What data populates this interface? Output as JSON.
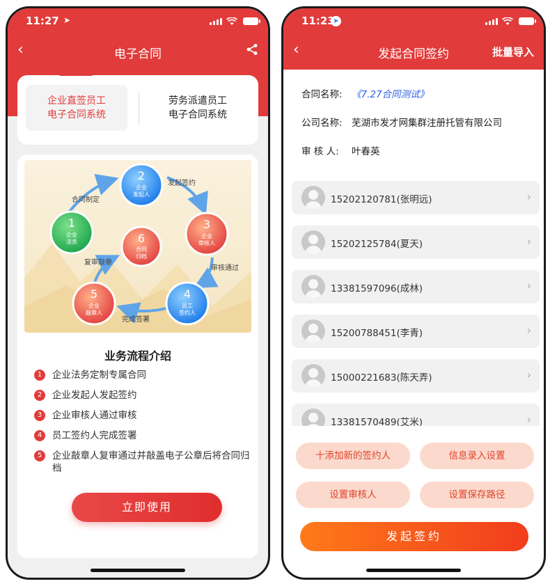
{
  "left": {
    "status": {
      "time": "11:27"
    },
    "nav": {
      "title": "电子合同"
    },
    "tabs": [
      {
        "line1": "企业直签员工",
        "line2": "电子合同系统"
      },
      {
        "line1": "劳务派遣员工",
        "line2": "电子合同系统"
      }
    ],
    "flow": {
      "nodes": [
        {
          "num": "1",
          "label1": "企业",
          "label2": "法务"
        },
        {
          "num": "2",
          "label1": "企业",
          "label2": "发起人"
        },
        {
          "num": "3",
          "label1": "企业",
          "label2": "审核人"
        },
        {
          "num": "4",
          "label1": "员工",
          "label2": "签约人"
        },
        {
          "num": "5",
          "label1": "企业",
          "label2": "敲章人"
        },
        {
          "num": "6",
          "label1": "合同",
          "label2": "归档"
        }
      ],
      "arrows": [
        "合同制定",
        "发起签约",
        "审核通过",
        "完成签署",
        "复审敲章"
      ]
    },
    "section_title": "业务流程介绍",
    "steps": [
      {
        "num": "1",
        "text": "企业法务定制专属合同"
      },
      {
        "num": "2",
        "text": "企业发起人发起签约"
      },
      {
        "num": "3",
        "text": "企业审核人通过审核"
      },
      {
        "num": "4",
        "text": "员工签约人完成签署"
      },
      {
        "num": "5",
        "text": "企业敲章人复审通过并敲盖电子公章后将合同归档"
      }
    ],
    "use_button": "立即使用"
  },
  "right": {
    "status": {
      "time": "11:23"
    },
    "nav": {
      "title": "发起合同签约",
      "action": "批量导入"
    },
    "info": {
      "contract_label": "合同名称:",
      "contract_value": "《7.27合同测试》",
      "company_label": "公司名称:",
      "company_value": "芜湖市发才网集群注册托管有限公司",
      "reviewer_label": "审 核 人:",
      "reviewer_value": "叶春英"
    },
    "signers": [
      "15202120781(张明远)",
      "15202125784(夏天)",
      "13381597096(成林)",
      "15200788451(李青)",
      "15000221683(陈天弄)",
      "13381570489(艾米)"
    ],
    "buttons": {
      "add_signer": "十添加新的签约人",
      "info_settings": "信息录入设置",
      "set_reviewer": "设置审核人",
      "save_path": "设置保存路径",
      "sign": "发起签约"
    },
    "colors": {
      "accent": "#e23b3b",
      "sign_button": "#f5561c"
    },
    "icons": [
      "back-chevron-icon",
      "share-icon",
      "location-arrow-icon",
      "signal-icon",
      "wifi-icon",
      "battery-icon",
      "avatar-placeholder-icon",
      "chevron-right-icon"
    ]
  }
}
